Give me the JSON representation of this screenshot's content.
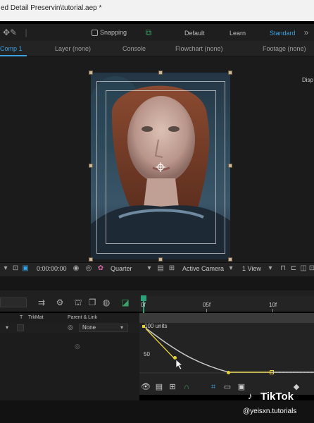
{
  "window": {
    "title": "ed Detail Preservin\\tutorial.aep *"
  },
  "toolbar": {
    "snapping_label": "Snapping",
    "workspaces": [
      "Default",
      "Learn",
      "Standard"
    ],
    "active_workspace": "Standard"
  },
  "panel_tabs": {
    "comp": "Comp 1",
    "layer": "Layer (none)",
    "console": "Console",
    "flowchart": "Flowchart (none)",
    "footage": "Footage (none)"
  },
  "viewer": {
    "side_label": "Disp",
    "timecode": "0:00:00:00",
    "resolution": "Quarter",
    "camera": "Active Camera",
    "views": "1 View"
  },
  "timeline": {
    "ruler_marks": [
      "0f",
      "05f",
      "10f"
    ],
    "columns": {
      "t": "T",
      "trkmat": "TrkMat",
      "parent": "Parent & Link"
    },
    "parent_value": "None"
  },
  "graph_editor": {
    "top_value": "100 units",
    "mid_value": "50"
  },
  "watermark": {
    "brand": "TikTok",
    "user": "@yeisxn.tutorials"
  },
  "colors": {
    "accent": "#3aa0e0",
    "curve": "#c8c8c8",
    "keyframe": "#e6d23a"
  }
}
